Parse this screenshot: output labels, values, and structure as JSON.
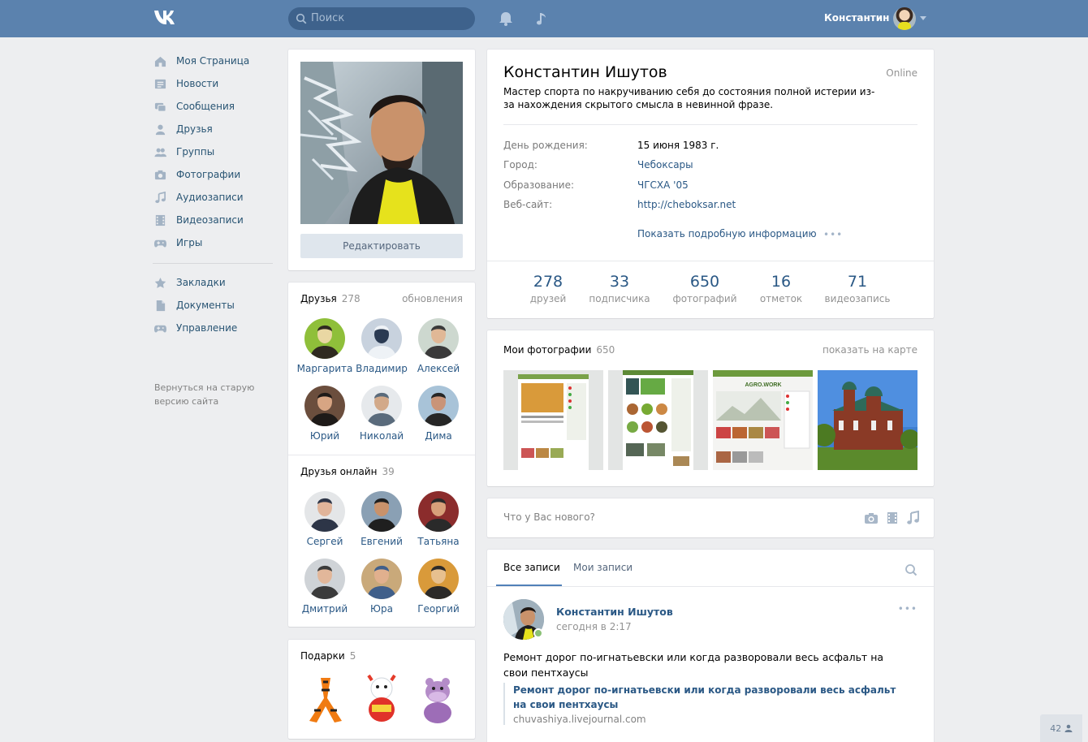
{
  "header": {
    "logo": "VK",
    "search_placeholder": "Поиск",
    "user_name": "Константин"
  },
  "nav": {
    "items": [
      {
        "label": "Моя Страница",
        "icon": "home-icon"
      },
      {
        "label": "Новости",
        "icon": "news-icon"
      },
      {
        "label": "Сообщения",
        "icon": "messages-icon"
      },
      {
        "label": "Друзья",
        "icon": "user-icon"
      },
      {
        "label": "Группы",
        "icon": "users-icon"
      },
      {
        "label": "Фотографии",
        "icon": "camera-icon"
      },
      {
        "label": "Аудиозаписи",
        "icon": "music-icon"
      },
      {
        "label": "Видеозаписи",
        "icon": "film-icon"
      },
      {
        "label": "Игры",
        "icon": "gamepad-icon"
      }
    ],
    "items2": [
      {
        "label": "Закладки",
        "icon": "star-icon"
      },
      {
        "label": "Документы",
        "icon": "document-icon"
      },
      {
        "label": "Управление",
        "icon": "gamepad-icon"
      }
    ],
    "footer": "Вернуться на старую версию сайта"
  },
  "avatar_card": {
    "edit_label": "Редактировать"
  },
  "friends": {
    "title": "Друзья",
    "count": "278",
    "updates_link": "обновления",
    "list": [
      "Маргарита",
      "Владимир",
      "Алексей",
      "Юрий",
      "Николай",
      "Дима"
    ],
    "online_title": "Друзья онлайн",
    "online_count": "39",
    "online_list": [
      "Сергей",
      "Евгений",
      "Татьяна",
      "Дмитрий",
      "Юра",
      "Георгий"
    ]
  },
  "gifts": {
    "title": "Подарки",
    "count": "5"
  },
  "profile": {
    "name": "Константин Ишутов",
    "online": "Online",
    "status": "Мастер спорта по накручиванию себя до состояния полной истерии из-за нахождения скрытого смысла в невинной фразе.",
    "rows": [
      {
        "label": "День рождения:",
        "value": "15 июня 1983 г."
      },
      {
        "label": "Город:",
        "value": "Чебоксары"
      },
      {
        "label": "Образование:",
        "value": "ЧГСХА '05"
      },
      {
        "label": "Веб-сайт:",
        "value": "http://cheboksar.net"
      }
    ],
    "more_link": "Показать подробную информацию",
    "more_dots": "•••",
    "counters": [
      {
        "num": "278",
        "label": "друзей"
      },
      {
        "num": "33",
        "label": "подписчика"
      },
      {
        "num": "650",
        "label": "фотографий"
      },
      {
        "num": "16",
        "label": "отметок"
      },
      {
        "num": "71",
        "label": "видеозапись"
      }
    ]
  },
  "photos": {
    "title": "Мои фотографии",
    "count": "650",
    "map_link": "показать на карте",
    "thumb3_text": "AGRO.WORK"
  },
  "post_box": {
    "placeholder": "Что у Вас нового?"
  },
  "wall": {
    "tab_all": "Все записи",
    "tab_mine": "Мои записи",
    "post": {
      "author": "Константин Ишутов",
      "time": "сегодня в 2:17",
      "dots": "•••",
      "text": "Ремонт дорог по-игнатьевски или когда разворовали весь асфальт на свои пентхаусы",
      "quote_title": "Ремонт дорог по-игнатьевски или когда разворовали весь асфальт на свои пентхаусы",
      "quote_source": "chuvashiya.livejournal.com"
    }
  },
  "corner_badge": "42",
  "colors": {
    "header": "#5b82ae",
    "link": "#2a5885",
    "background": "#edeef0"
  }
}
